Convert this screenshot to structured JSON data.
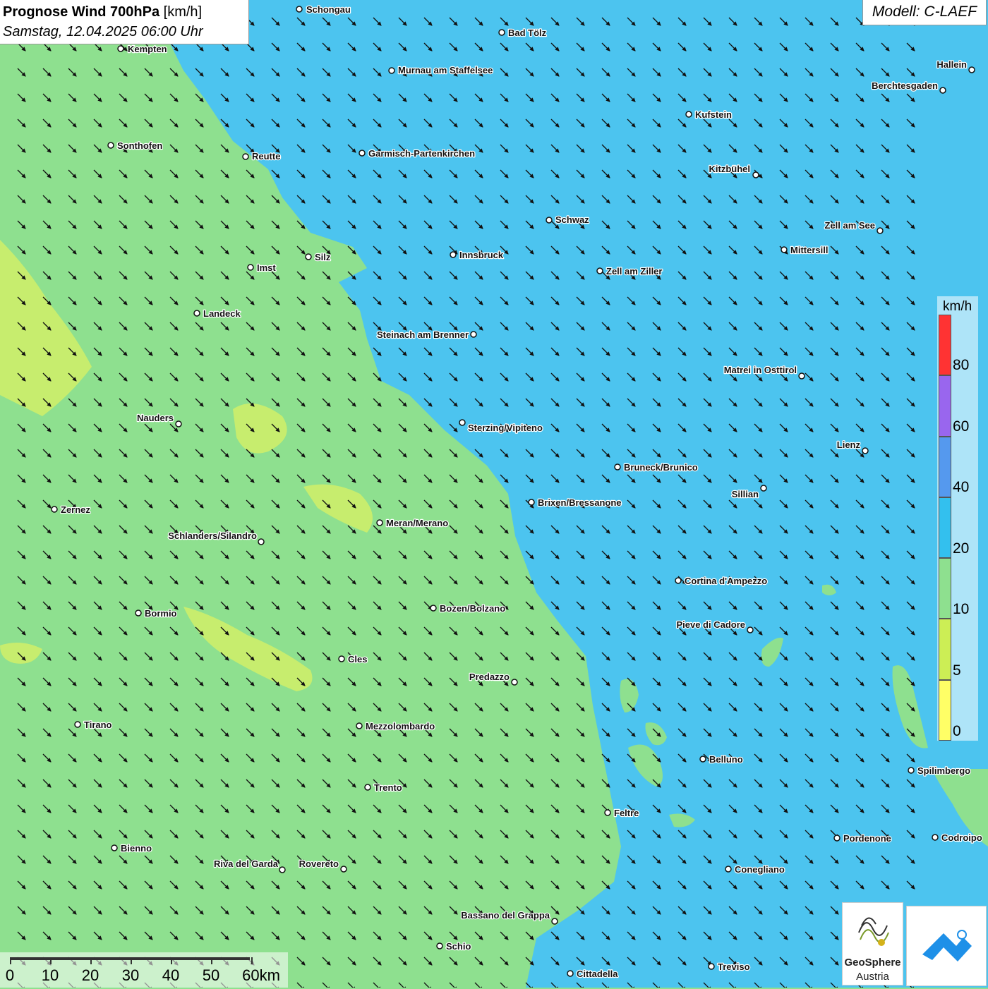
{
  "title": {
    "bold": "Prognose Wind 700hPa",
    "unit": " [km/h]",
    "datetime": "Samstag, 12.04.2025 06:00 Uhr"
  },
  "model": "Modell: C-LAEF",
  "legend": {
    "unit": "km/h",
    "bands": [
      {
        "from": 0,
        "to": 5,
        "color": "#ffff66"
      },
      {
        "from": 5,
        "to": 10,
        "color": "#ccee55"
      },
      {
        "from": 10,
        "to": 20,
        "color": "#8ee08f"
      },
      {
        "from": 20,
        "to": 40,
        "color": "#33c0ee"
      },
      {
        "from": 40,
        "to": 60,
        "color": "#5599ee"
      },
      {
        "from": 60,
        "to": 80,
        "color": "#9966ee"
      },
      {
        "from": 80,
        "to": 100,
        "color": "#ff3333"
      }
    ],
    "labels": [
      "80",
      "60",
      "40",
      "20",
      "10",
      "5",
      "0"
    ]
  },
  "scale": {
    "labels": [
      "0",
      "10",
      "20",
      "30",
      "40",
      "50",
      "60km"
    ]
  },
  "logos": {
    "geosphere_line1": "GeoSphere",
    "geosphere_line2": "Austria"
  },
  "cities": [
    {
      "name": "Schongau"
    },
    {
      "name": "Bad Tölz"
    },
    {
      "name": "Kempten"
    },
    {
      "name": "Murnau am Staffelsee"
    },
    {
      "name": "Hallein"
    },
    {
      "name": "Berchtesgaden"
    },
    {
      "name": "Kufstein"
    },
    {
      "name": "Sonthofen"
    },
    {
      "name": "Reutte"
    },
    {
      "name": "Garmisch-Partenkirchen"
    },
    {
      "name": "Kitzbühel"
    },
    {
      "name": "Schwaz"
    },
    {
      "name": "Zell am See"
    },
    {
      "name": "Mittersill"
    },
    {
      "name": "Innsbruck"
    },
    {
      "name": "Silz"
    },
    {
      "name": "Imst"
    },
    {
      "name": "Zell am Ziller"
    },
    {
      "name": "Landeck"
    },
    {
      "name": "Steinach am Brenner"
    },
    {
      "name": "Matrei in Osttirol"
    },
    {
      "name": "Nauders"
    },
    {
      "name": "Sterzing/Vipiteno"
    },
    {
      "name": "Lienz"
    },
    {
      "name": "Bruneck/Brunico"
    },
    {
      "name": "Sillian"
    },
    {
      "name": "Brixen/Bressanone"
    },
    {
      "name": "Zernez"
    },
    {
      "name": "Meran/Merano"
    },
    {
      "name": "Schlanders/Silandro"
    },
    {
      "name": "Cortina d'Ampezzo"
    },
    {
      "name": "Bozen/Bolzano"
    },
    {
      "name": "Bormio"
    },
    {
      "name": "Pieve di Cadore"
    },
    {
      "name": "Cles"
    },
    {
      "name": "Predazzo"
    },
    {
      "name": "Tirano"
    },
    {
      "name": "Mezzolombardo"
    },
    {
      "name": "Belluno"
    },
    {
      "name": "Spilimbergo"
    },
    {
      "name": "Trento"
    },
    {
      "name": "Feltre"
    },
    {
      "name": "Pordenone"
    },
    {
      "name": "Codroipo"
    },
    {
      "name": "Bienno"
    },
    {
      "name": "Riva del Garda"
    },
    {
      "name": "Rovereto"
    },
    {
      "name": "Conegliano"
    },
    {
      "name": "Bassano del Grappa"
    },
    {
      "name": "Schio"
    },
    {
      "name": "Treviso"
    },
    {
      "name": "Cittadella"
    }
  ]
}
